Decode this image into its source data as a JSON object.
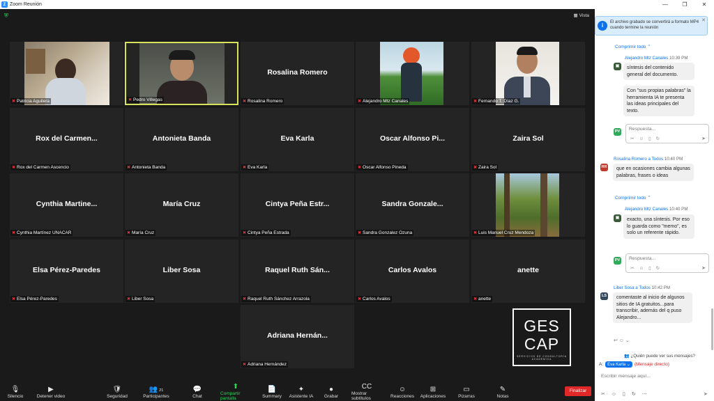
{
  "window": {
    "title": "Zoom Reunión",
    "controls": [
      "—",
      "❐",
      "✕"
    ]
  },
  "view": {
    "label": "Vista"
  },
  "tiles": [
    {
      "name": "Patricia Aguilera",
      "display": "",
      "video": "patricia"
    },
    {
      "name": "Pedro Villegas",
      "display": "",
      "video": "pedro",
      "active": true
    },
    {
      "name": "Rosalina Romero",
      "display": "Rosalina Romero"
    },
    {
      "name": "Alejandro Mtz Canales",
      "display": "",
      "video": "alejandro"
    },
    {
      "name": "Fernando T. Díaz G.",
      "display": "",
      "video": "fernando"
    },
    {
      "name": "Rox del Carmen Ascencio",
      "display": "Rox del Carmen..."
    },
    {
      "name": "Antonieta Banda",
      "display": "Antonieta Banda"
    },
    {
      "name": "Eva Karla",
      "display": "Eva Karla"
    },
    {
      "name": "Oscar Alfonso Pineda",
      "display": "Oscar Alfonso Pi..."
    },
    {
      "name": "Zaira Sol",
      "display": "Zaira Sol"
    },
    {
      "name": "Cynthia Martínez UNACAR",
      "display": "Cynthia Martine..."
    },
    {
      "name": "María Cruz",
      "display": "María Cruz"
    },
    {
      "name": "Cintya Peña Estrada",
      "display": "Cintya Peña Estr..."
    },
    {
      "name": "Sandra  Gonzalez Ozuna",
      "display": "Sandra  Gonzale..."
    },
    {
      "name": "Luis Manuel Cruz Mendoza",
      "display": "",
      "video": "luis"
    },
    {
      "name": "Elsa Pérez-Paredes",
      "display": "Elsa Pérez-Paredes"
    },
    {
      "name": "Liber Sosa",
      "display": "Liber Sosa"
    },
    {
      "name": "Raquel Ruth Sánchez Arrazola",
      "display": "Raquel Ruth Sán..."
    },
    {
      "name": "Carlos Avalos",
      "display": "Carlos Avalos"
    },
    {
      "name": "anette",
      "display": "anette"
    },
    {
      "name": "Adriana Hernández",
      "display": "Adriana Hernán..."
    }
  ],
  "logo": {
    "line1": "GES",
    "line2": "CAP",
    "sub": "SERVICIOS DE CONSULTORÍA ACADÉMICA"
  },
  "toolbar": {
    "items": [
      {
        "label": "Silencio",
        "icon": "🎙"
      },
      {
        "label": "Detener video",
        "icon": "▶"
      },
      {
        "label": "Seguridad",
        "icon": "🛡"
      },
      {
        "label": "Participantes",
        "icon": "👥",
        "badge": "21"
      },
      {
        "label": "Chat",
        "icon": "💬"
      },
      {
        "label": "Compartir pantalla",
        "icon": "⬆"
      },
      {
        "label": "Summary",
        "icon": "📄"
      },
      {
        "label": "Asistente IA",
        "icon": "✦"
      },
      {
        "label": "Grabar",
        "icon": "●"
      },
      {
        "label": "Mostrar subtítulos",
        "icon": "CC"
      },
      {
        "label": "Reacciones",
        "icon": "☺"
      },
      {
        "label": "Aplicaciones",
        "icon": "⊞"
      },
      {
        "label": "Pizarras",
        "icon": "▭"
      },
      {
        "label": "Notas",
        "icon": "✎"
      }
    ],
    "end_label": "Finalizar"
  },
  "chat": {
    "notice": "El archivo grabado se convertirá a formato MP4 cuando termine la reunión",
    "collapse_label": "Comprimir todo",
    "reply_placeholder": "Respuesta...",
    "messages": [
      {
        "sender": "Alejandro Mtz Canales",
        "time": "10:39 PM",
        "lines": [
          "síntesis del contenido general del documento.",
          "Con \"sus propias palabras\" la herramienta IA te presenta las ideas principales del texto."
        ]
      },
      {
        "sender": "Rosalina Romero a Todos",
        "time": "10:40 PM",
        "avatar": "RR",
        "text": "que en ocasiones cambia algunas palabras, frases o ideas"
      },
      {
        "sender": "Alejandro Mtz Canales",
        "time": "10:40 PM",
        "text": "exacto, una síntesis. Por eso lo guarda como \"memo\", es solo un referente rápido."
      },
      {
        "sender": "Liber Sosa a Todos",
        "time": "10:42 PM",
        "avatar": "LS",
        "text": "comentaste al inicio de algunos sitios de IA gratuitos...para transcribir, además del q puso Alejandro..."
      }
    ],
    "pv_avatar": "PV",
    "who_can_see": "¿Quién puede ver sus mensajes?",
    "to_label": "A:",
    "to_recipient": "Eva Karla",
    "direct_label": "(Mensaje directo)",
    "input_placeholder": "Escribir mensaje aquí..."
  }
}
